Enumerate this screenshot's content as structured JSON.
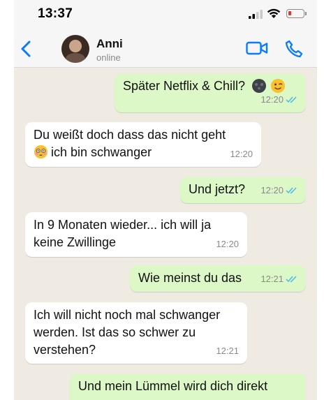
{
  "status_bar": {
    "time": "13:37"
  },
  "header": {
    "contact_name": "Anni",
    "contact_status": "online"
  },
  "messages": [
    {
      "direction": "out",
      "text": "Später Netflix & Chill?",
      "emojis": [
        "new-moon-face",
        "winking-face"
      ],
      "time": "12:20",
      "read": true
    },
    {
      "direction": "in",
      "line1": "Du weißt doch dass das nicht geht",
      "line2_text": "ich bin schwanger",
      "line2_emoji": "flushed-face",
      "time": "12:20"
    },
    {
      "direction": "out",
      "text": "Und jetzt?",
      "time": "12:20",
      "read": true
    },
    {
      "direction": "in",
      "line1": "In 9 Monaten wieder... ich will ja",
      "line2": "keine Zwillinge",
      "time": "12:20"
    },
    {
      "direction": "out",
      "text": "Wie meinst du das",
      "time": "12:21",
      "read": true
    },
    {
      "direction": "in",
      "line1": "Ich will nicht noch mal schwanger",
      "line2": "werden. Ist das so schwer zu",
      "line3": "verstehen?",
      "time": "12:21"
    },
    {
      "direction": "out",
      "line1": "Und mein Lümmel wird dich direkt"
    }
  ],
  "colors": {
    "accent": "#0a7aff",
    "outgoing_bubble": "#dcf8c6",
    "incoming_bubble": "#ffffff",
    "chat_background": "#efeae2",
    "read_ticks": "#4fb6ec"
  },
  "icons": {
    "back": "chevron-left-icon",
    "video": "video-camera-icon",
    "call": "phone-icon"
  }
}
